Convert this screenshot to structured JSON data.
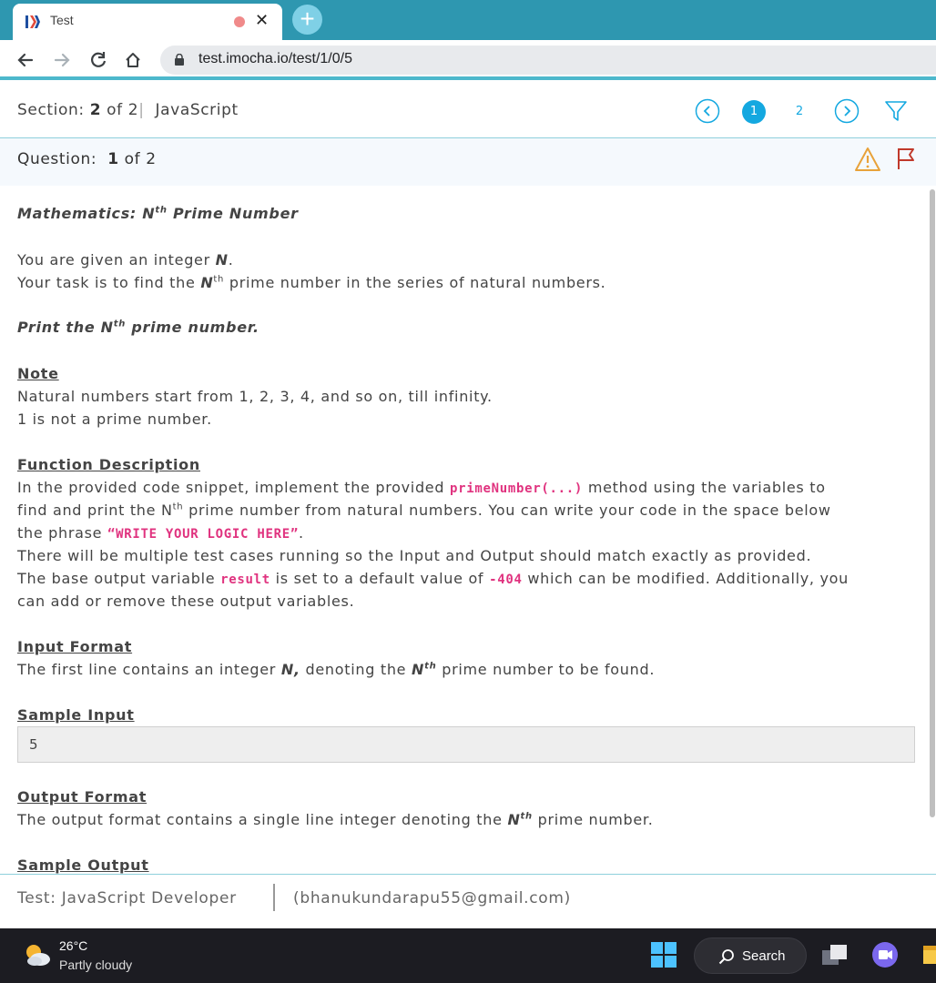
{
  "browser": {
    "tab_title": "Test",
    "url": "test.imocha.io/test/1/0/5"
  },
  "section": {
    "label": "Section:",
    "current": "2",
    "of_total": "of 2",
    "separator": "|",
    "name": "JavaScript",
    "pages": [
      "1",
      "2"
    ]
  },
  "question": {
    "label": "Question:",
    "current": "1",
    "of_total": "of 2"
  },
  "content": {
    "title_main": "Mathematics: N",
    "title_sup": "th",
    "title_rest": " Prime Number",
    "intro1_a": "You are given an integer ",
    "intro1_n": "N",
    "intro1_b": ".",
    "intro2_a": "Your task is to find the ",
    "intro2_n": "N",
    "intro2_sup": "th",
    "intro2_b": " prime number in the series of natural numbers.",
    "print_a": "Print the N",
    "print_sup": "th",
    "print_b": " prime number.",
    "note_heading": "Note",
    "note1": "Natural numbers start from 1, 2, 3, 4, and so on, till infinity.",
    "note2": "1 is not a prime number.",
    "func_heading": "Function Description",
    "func1_a": "In the provided code snippet, implement the provided ",
    "func1_code": "primeNumber(...)",
    "func1_b": " method using the variables to",
    "func2_a": "find and print the N",
    "func2_sup": "th",
    "func2_b": " prime number from natural numbers. You can write your code in the space below",
    "func3_a": "the phrase ",
    "func3_code": "“WRITE YOUR LOGIC HERE”",
    "func3_b": ".",
    "func4": "There will be multiple test cases running so the Input and Output should match exactly as provided.",
    "func5_a": "The base output variable ",
    "func5_code1": "result",
    "func5_b": " is set to a default value of ",
    "func5_code2": "-404",
    "func5_c": " which can be modified. Additionally, you",
    "func6": "can add or remove these output variables.",
    "input_heading": "Input Format",
    "input_a": "The first line contains an integer ",
    "input_n": "N,",
    "input_b": " denoting the ",
    "input_n2": "N",
    "input_sup": "th",
    "input_c": " prime number to be found.",
    "sample_input_heading": "Sample Input",
    "sample_input_value": "5",
    "output_heading": "Output Format",
    "output_a": "The output format contains a single line integer denoting the ",
    "output_n": "N",
    "output_sup": "th",
    "output_b": " prime number.",
    "sample_output_heading": "Sample Output"
  },
  "footer": {
    "test_name": "Test: JavaScript Developer",
    "email": "(bhanukundarapu55@gmail.com)"
  },
  "taskbar": {
    "temperature": "26°C",
    "condition": "Partly cloudy",
    "search_label": "Search"
  },
  "colors": {
    "chrome_teal": "#2e97b0",
    "accent_blue": "#14a8e0",
    "code_pink": "#e0337f",
    "warning_orange": "#e8a23a",
    "flag_red": "#c0392b"
  }
}
